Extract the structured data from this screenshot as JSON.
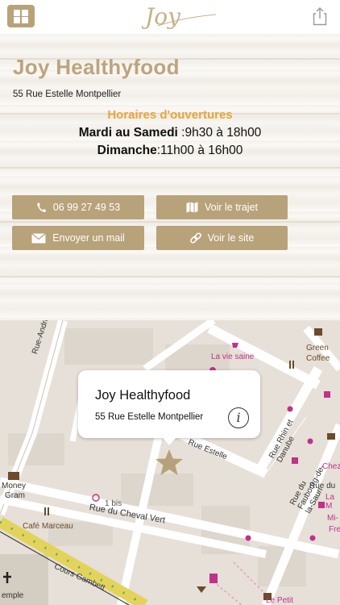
{
  "header": {
    "logo_text": "Joy"
  },
  "restaurant": {
    "name": "Joy Healthyfood",
    "address": "55 Rue Estelle Montpellier"
  },
  "hours": {
    "title": "Horaires d'ouvertures",
    "line1_days": "Mardi au Samedi",
    "line1_time": " :9h30 à 18h00",
    "line2_days": "Dimanche",
    "line2_time": ":11h00 à 16h00"
  },
  "actions": {
    "phone": "06 99 27 49 53",
    "route": "Voir le trajet",
    "mail": "Envoyer un mail",
    "site": "Voir le site"
  },
  "map": {
    "callout_title": "Joy Healthyfood",
    "callout_address": "55 Rue Estelle Montpellier",
    "labels": {
      "rue_andrieu": "Rue-André",
      "la_vie_saine": "La vie saine",
      "green_coffee_1": "Green",
      "green_coffee_2": "Coffee",
      "rue_rhin_danube": "Rue Rhin et Danube",
      "rue_estelle": "Rue Estelle",
      "rue_faubourg": "Rue du Faubourg-de-la-Saun",
      "rue_du": "Rue du",
      "chez": "Chez",
      "la_m": "La M",
      "mi": "Mi-",
      "fre": "Fre",
      "money_gram_1": "Money",
      "money_gram_2": "Gram",
      "one_bis": "1 bis",
      "rue_cheval_vert": "Rue du Cheval Vert",
      "cafe_marceau": "Café Marceau",
      "cours_gambetta": "Cours Gambett",
      "temple": "emple",
      "le_petit": "Le Petit"
    }
  },
  "colors": {
    "accent_gold": "#b8a27a",
    "hours_title": "#e8a63c",
    "poi_pink": "#c1318a"
  }
}
